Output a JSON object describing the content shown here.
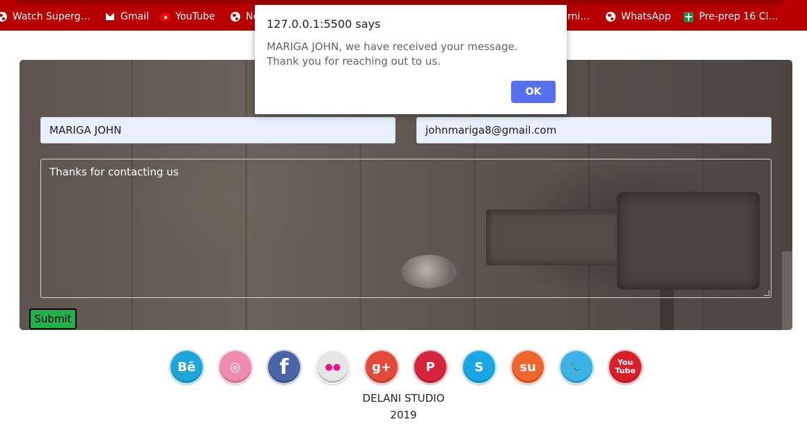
{
  "bookmarks": [
    {
      "label": "Watch Superg…",
      "icon": "globe-icon"
    },
    {
      "label": "Gmail",
      "icon": "gmail-icon"
    },
    {
      "label": "YouTube",
      "icon": "youtube-icon"
    },
    {
      "label": "Ne",
      "icon": "globe-icon"
    },
    {
      "label": "rni…",
      "icon": "globe-icon"
    },
    {
      "label": "WhatsApp",
      "icon": "globe-icon"
    },
    {
      "label": "Pre-prep 16 Cl…",
      "icon": "sheets-icon"
    }
  ],
  "form": {
    "name_value": "MARIGA JOHN",
    "email_value": "johnmariga8@gmail.com",
    "message_value": "Thanks for contacting us",
    "submit_label": "Submit"
  },
  "dialog": {
    "title": "127.0.0.1:5500 says",
    "message": "MARIGA JOHN, we have received your message. Thank you for reaching out to us.",
    "ok_label": "OK"
  },
  "social": [
    {
      "name": "behance-icon",
      "glyph": "Bē",
      "color": "#1ea6d9"
    },
    {
      "name": "dribbble-icon",
      "glyph": "◎",
      "color": "#f08cb2"
    },
    {
      "name": "facebook-icon",
      "glyph": "f",
      "color": "#4a64a8"
    },
    {
      "name": "flickr-icon",
      "glyph": "●●",
      "color": "#e6e6e6"
    },
    {
      "name": "google-plus-icon",
      "glyph": "g+",
      "color": "#e24b3b"
    },
    {
      "name": "pinterest-icon",
      "glyph": "P",
      "color": "#d6263d"
    },
    {
      "name": "skype-icon",
      "glyph": "S",
      "color": "#1ba7e5"
    },
    {
      "name": "stumbleupon-icon",
      "glyph": "su",
      "color": "#f0642d"
    },
    {
      "name": "twitter-icon",
      "glyph": "🐦",
      "color": "#3cb3e4"
    },
    {
      "name": "youtube-social-icon",
      "glyph": "You Tube",
      "color": "#d9202a"
    }
  ],
  "footer": {
    "studio": "DELANI STUDIO",
    "year": "2019"
  }
}
